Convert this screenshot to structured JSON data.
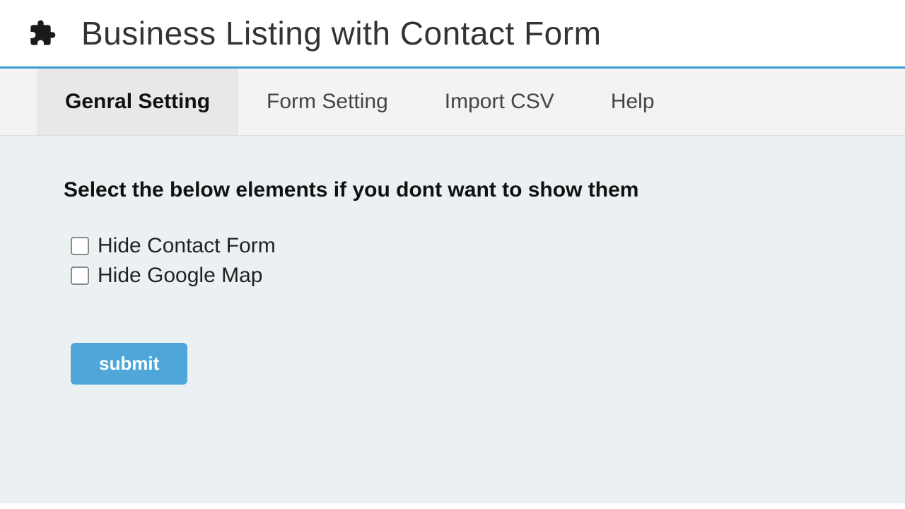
{
  "header": {
    "title": "Business Listing with Contact Form"
  },
  "tabs": [
    {
      "label": "Genral Setting",
      "active": true
    },
    {
      "label": "Form Setting",
      "active": false
    },
    {
      "label": "Import CSV",
      "active": false
    },
    {
      "label": "Help",
      "active": false
    }
  ],
  "content": {
    "heading": "Select the below elements if you dont want to show them",
    "checkboxes": [
      {
        "label": "Hide Contact Form",
        "checked": false
      },
      {
        "label": "Hide Google Map",
        "checked": false
      }
    ],
    "submit_label": "submit"
  }
}
